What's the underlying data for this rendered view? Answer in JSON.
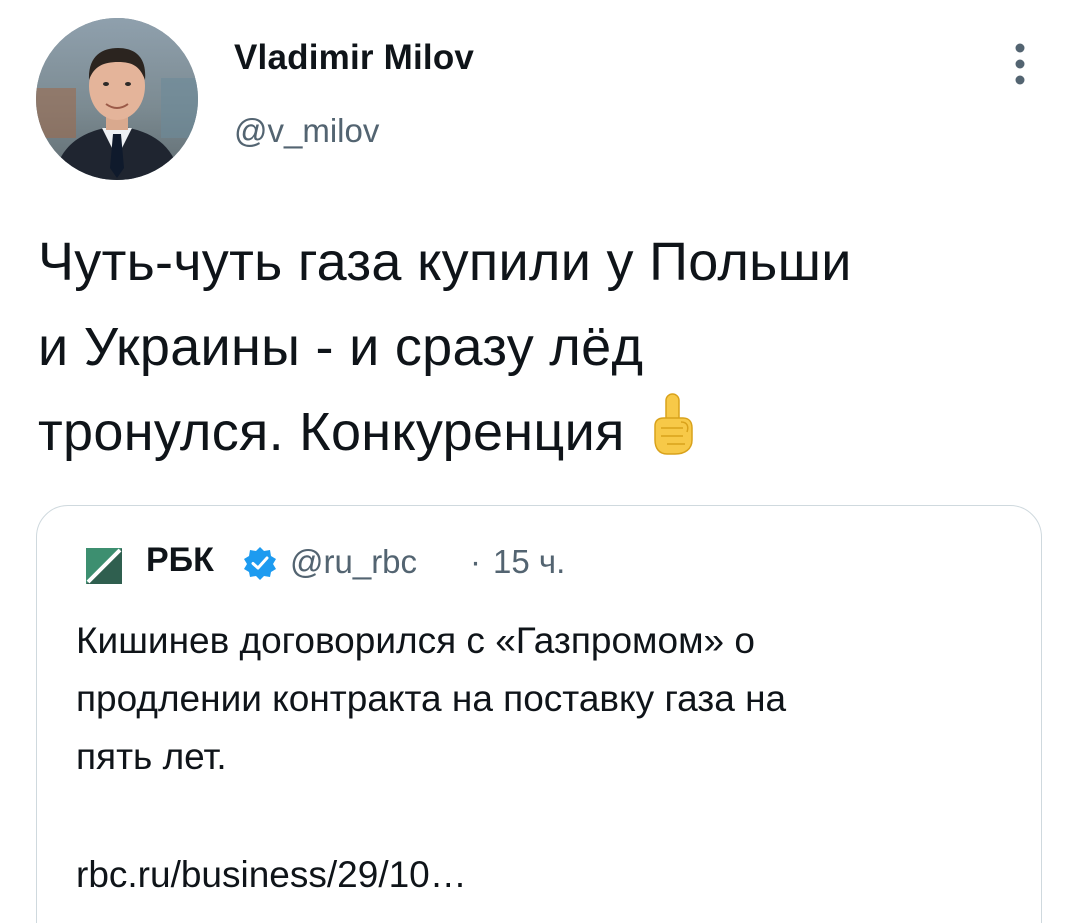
{
  "tweet": {
    "author": {
      "name": "Vladimir Milov",
      "handle": "@v_milov",
      "avatar": "profile-photo"
    },
    "menu_icon": "more-vertical-icon",
    "text_lines": [
      "Чуть-чуть газа купили у Польши",
      "и Украины - и сразу лёд",
      "тронулся. Конкуренция"
    ],
    "emoji": "pointing-up-emoji"
  },
  "quoted_tweet": {
    "logo_icon": "rbc-logo-icon",
    "name": "РБК",
    "verified_icon": "verified-badge-icon",
    "handle": "@ru_rbc",
    "separator": "·",
    "time": "15 ч.",
    "text_lines": [
      "Кишинев договорился с «Газпромом» о",
      "продлении контракта на поставку газа на",
      "пять лет."
    ],
    "link": "rbc.ru/business/29/10…"
  },
  "colors": {
    "text_primary": "#0f1419",
    "text_secondary": "#536471",
    "border": "#cfd9de",
    "verified": "#1d9bf0",
    "rbc_green": "#3d8f70"
  }
}
